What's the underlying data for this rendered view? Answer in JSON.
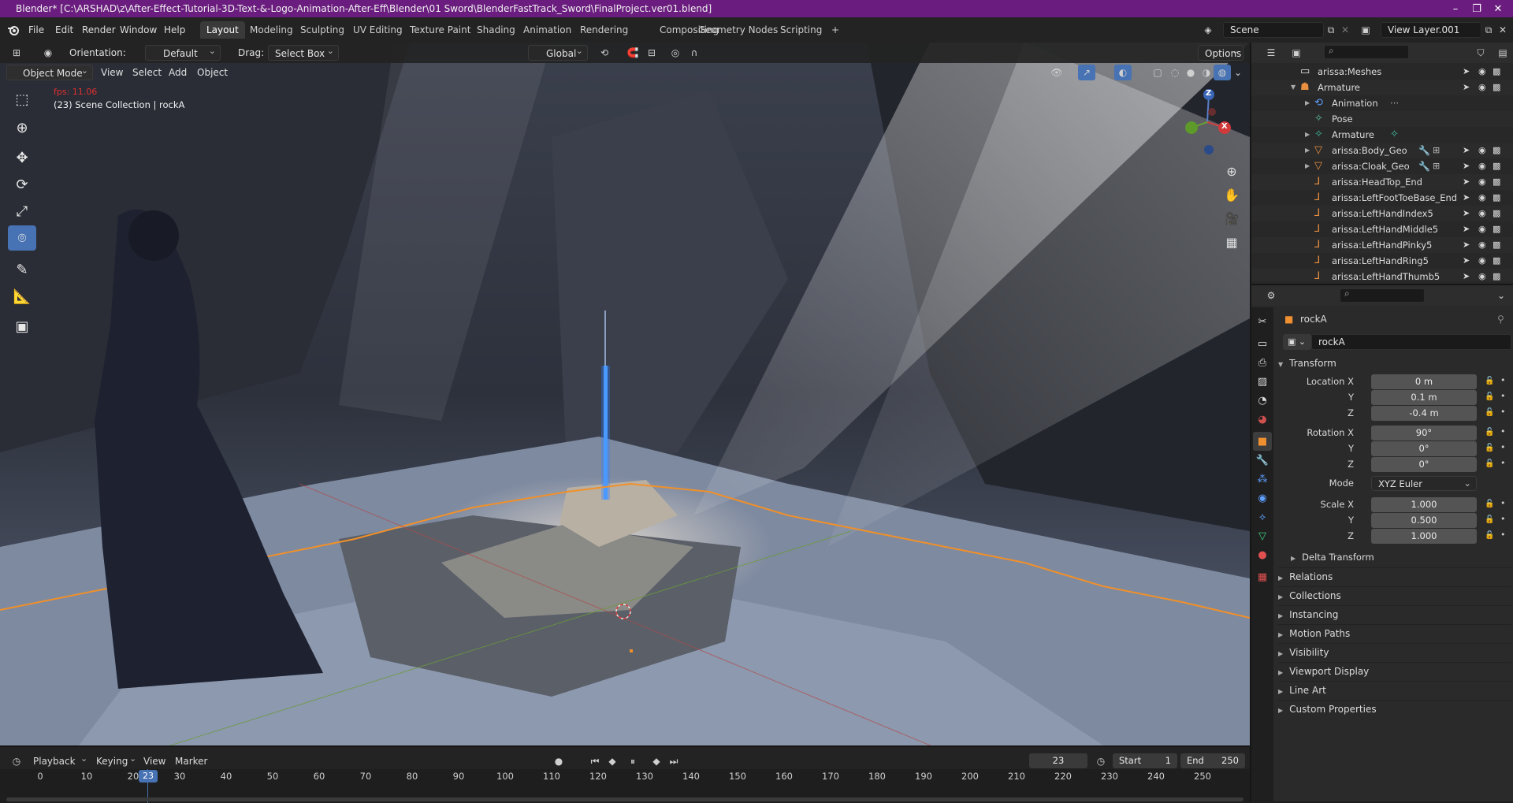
{
  "window": {
    "title": "Blender* [C:\\ARSHAD\\z\\After-Effect-Tutorial-3D-Text-&-Logo-Animation-After-Eff\\Blender\\01 Sword\\BlenderFastTrack_Sword\\FinalProject.ver01.blend]",
    "minimize": "–",
    "maximize": "❐",
    "close": "✕"
  },
  "menu": {
    "items": [
      "File",
      "Edit",
      "Render",
      "Window",
      "Help"
    ]
  },
  "workspaces": {
    "tabs": [
      "Layout",
      "Modeling",
      "Sculpting",
      "UV Editing",
      "Texture Paint",
      "Shading",
      "Animation",
      "Rendering",
      "Compositing",
      "Geometry Nodes",
      "Scripting"
    ],
    "active": "Layout",
    "add": "+"
  },
  "scene": {
    "name": "Scene",
    "view_layer": "View Layer.001"
  },
  "viewport_header": {
    "orientation_label": "Orientation:",
    "orientation_value": "Default",
    "drag_label": "Drag:",
    "drag_value": "Select Box",
    "transform_space": "Global",
    "options": "Options"
  },
  "viewport_header2": {
    "mode": "Object Mode",
    "menus": [
      "View",
      "Select",
      "Add",
      "Object"
    ]
  },
  "viewport_overlay": {
    "fps": "fps: 11.06",
    "collection": "(23) Scene Collection | rockA"
  },
  "gizmo": {
    "z": "Z",
    "x": "X"
  },
  "outliner": {
    "rows": [
      {
        "label": "arissa:Meshes",
        "icon": "collection-icon"
      },
      {
        "label": "Armature",
        "icon": "armature-icon"
      },
      {
        "label": "Animation",
        "icon": "animation-icon"
      },
      {
        "label": "Pose",
        "icon": "pose-icon"
      },
      {
        "label": "Armature",
        "icon": "armature-data-icon"
      },
      {
        "label": "arissa:Body_Geo",
        "icon": "mesh-icon"
      },
      {
        "label": "arissa:Cloak_Geo",
        "icon": "mesh-icon"
      },
      {
        "label": "arissa:HeadTop_End",
        "icon": "bone-icon"
      },
      {
        "label": "arissa:LeftFootToeBase_End",
        "icon": "bone-icon"
      },
      {
        "label": "arissa:LeftHandIndex5",
        "icon": "bone-icon"
      },
      {
        "label": "arissa:LeftHandMiddle5",
        "icon": "bone-icon"
      },
      {
        "label": "arissa:LeftHandPinky5",
        "icon": "bone-icon"
      },
      {
        "label": "arissa:LeftHandRing5",
        "icon": "bone-icon"
      },
      {
        "label": "arissa:LeftHandThumb5",
        "icon": "bone-icon"
      }
    ]
  },
  "properties": {
    "object_name": "rockA",
    "data_name": "rockA",
    "transform_header": "Transform",
    "location": {
      "label_x": "Location X",
      "x": "0 m",
      "y": "0.1 m",
      "z": "-0.4 m"
    },
    "rotation": {
      "label_x": "Rotation X",
      "x": "90°",
      "y": "0°",
      "z": "0°"
    },
    "mode_label": "Mode",
    "mode_value": "XYZ Euler",
    "scale": {
      "label_x": "Scale X",
      "x": "1.000",
      "y": "0.500",
      "z": "1.000"
    },
    "axis_y": "Y",
    "axis_z": "Z",
    "delta_transform": "Delta Transform",
    "sections": [
      "Relations",
      "Collections",
      "Instancing",
      "Motion Paths",
      "Visibility",
      "Viewport Display",
      "Line Art",
      "Custom Properties"
    ]
  },
  "timeline": {
    "menus": [
      "Playback",
      "Keying",
      "View",
      "Marker"
    ],
    "current_frame": "23",
    "start_label": "Start",
    "start": "1",
    "end_label": "End",
    "end": "250",
    "ticks": [
      "0",
      "10",
      "20",
      "30",
      "40",
      "50",
      "60",
      "70",
      "80",
      "90",
      "100",
      "110",
      "120",
      "130",
      "140",
      "150",
      "160",
      "170",
      "180",
      "190",
      "200",
      "210",
      "220",
      "230",
      "240",
      "250"
    ],
    "playhead": "23"
  },
  "colors": {
    "titlebar": "#6a1d7e",
    "accent": "#4772b3",
    "selection_outline": "#f0902a",
    "playhead": "#4772b3"
  }
}
